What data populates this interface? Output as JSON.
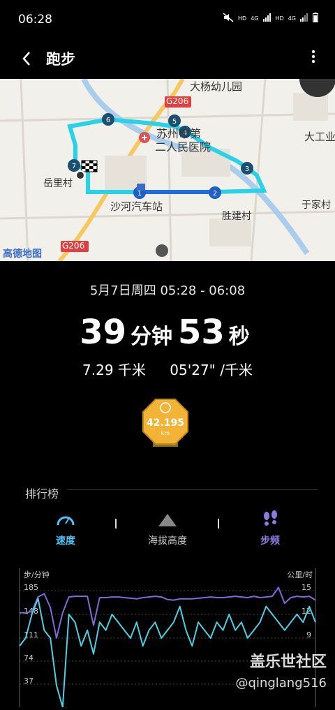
{
  "status": {
    "time": "06:28",
    "icons": [
      "mute-icon",
      "hd-icon",
      "signal-icon",
      "hd-icon",
      "signal-icon",
      "battery-icon"
    ],
    "hd1": "HD",
    "g1": "4G",
    "hd2": "HD",
    "g2": "4G"
  },
  "header": {
    "title": "跑步"
  },
  "map": {
    "labels": {
      "kindergarten": "大杨幼儿园",
      "road_top": "G206",
      "hospital_a": "苏州市第",
      "hospital_b": "二人民医院",
      "dagong": "大工业",
      "yueli": "岳里村",
      "station": "沙河汽车站",
      "shengjian": "胜建村",
      "yujia": "于家村",
      "amap": "高德地图",
      "road_bottom": "G206"
    },
    "markers": [
      "1",
      "2",
      "3",
      "4",
      "5",
      "6",
      "7"
    ]
  },
  "workout": {
    "date": "5月7日周四 05:28 - 06:08",
    "minutes": "39",
    "minutes_unit": "分钟",
    "seconds": "53",
    "seconds_unit": "秒",
    "distance": "7.29 千米",
    "pace": "05'27\" /千米",
    "badge": {
      "value": "42.195",
      "unit": "km"
    }
  },
  "ranking": {
    "title": "排行榜",
    "tabs": [
      {
        "label": "速度",
        "active": true,
        "color": "#4fc3f7"
      },
      {
        "label": "海拔高度",
        "active": false,
        "color": "#cccccc"
      },
      {
        "label": "步频",
        "active": true,
        "color": "#9575cd"
      }
    ]
  },
  "chart_data": {
    "type": "line",
    "left_axis": {
      "label": "步/分钟",
      "ticks": [
        185,
        148,
        111,
        74,
        37
      ]
    },
    "right_axis": {
      "label": "公里/时",
      "ticks": [
        15,
        12,
        9
      ]
    },
    "series": [
      {
        "axis": "left",
        "color": "#7e6ad8",
        "values": [
          150,
          150,
          152,
          175,
          180,
          158,
          110,
          150,
          175,
          176,
          176,
          176,
          130,
          174,
          174,
          175,
          175,
          174,
          173,
          172,
          174,
          175,
          176,
          175,
          171,
          170,
          172,
          172,
          172,
          173,
          174,
          175,
          174,
          174,
          175,
          176,
          175,
          174,
          176,
          174,
          175,
          176,
          190,
          165,
          174,
          176,
          175,
          176,
          170
        ]
      },
      {
        "axis": "right",
        "color": "#4dd0e1",
        "values": [
          8,
          9,
          12,
          14,
          10,
          9,
          3,
          -1,
          12,
          11,
          8,
          10,
          7,
          11,
          10,
          12,
          11,
          10,
          9,
          11,
          8,
          10,
          11,
          9,
          10,
          11,
          13,
          10,
          8,
          11,
          10,
          9,
          11,
          10,
          12,
          10,
          11,
          9,
          10,
          11,
          13,
          12,
          11,
          10,
          11,
          12,
          11,
          13,
          11
        ]
      }
    ]
  },
  "watermark": {
    "line1": "盖乐世社区",
    "line2": "@qinglang516"
  }
}
